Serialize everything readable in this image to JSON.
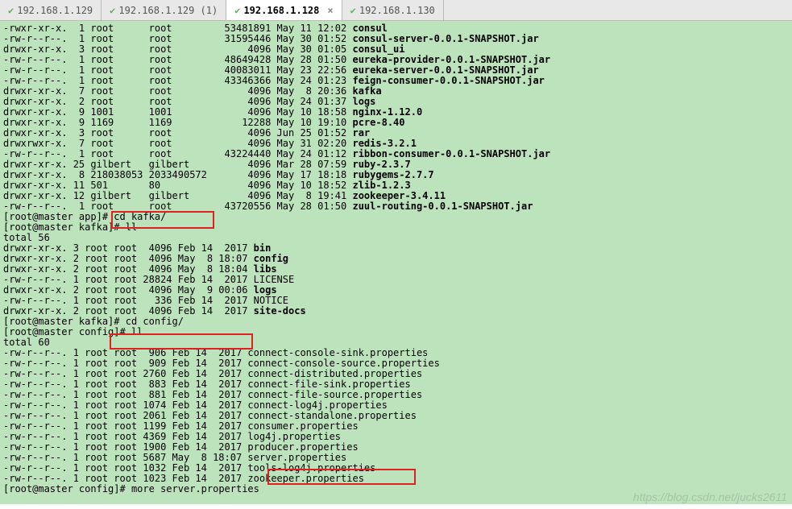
{
  "tabs": [
    {
      "label": "192.168.1.129",
      "active": false,
      "closable": false
    },
    {
      "label": "192.168.1.129 (1)",
      "active": false,
      "closable": false
    },
    {
      "label": "192.168.1.128",
      "active": true,
      "closable": true
    },
    {
      "label": "192.168.1.130",
      "active": false,
      "closable": false
    }
  ],
  "app_listing": {
    "rows": [
      {
        "perm": "-rwxr-xr-x.",
        "links": "1",
        "owner": "root",
        "group": "root",
        "size": "53481891",
        "date": "May 11 12:02",
        "name": "consul",
        "bold": true
      },
      {
        "perm": "-rw-r--r--.",
        "links": "1",
        "owner": "root",
        "group": "root",
        "size": "31595446",
        "date": "May 30 01:52",
        "name": "consul-server-0.0.1-SNAPSHOT.jar",
        "bold": true
      },
      {
        "perm": "drwxr-xr-x.",
        "links": "3",
        "owner": "root",
        "group": "root",
        "size": "4096",
        "date": "May 30 01:05",
        "name": "consul_ui",
        "bold": true
      },
      {
        "perm": "-rw-r--r--.",
        "links": "1",
        "owner": "root",
        "group": "root",
        "size": "48649428",
        "date": "May 28 01:50",
        "name": "eureka-provider-0.0.1-SNAPSHOT.jar",
        "bold": true
      },
      {
        "perm": "-rw-r--r--.",
        "links": "1",
        "owner": "root",
        "group": "root",
        "size": "40083011",
        "date": "May 23 22:56",
        "name": "eureka-server-0.0.1-SNAPSHOT.jar",
        "bold": true
      },
      {
        "perm": "-rw-r--r--.",
        "links": "1",
        "owner": "root",
        "group": "root",
        "size": "43346366",
        "date": "May 24 01:23",
        "name": "feign-consumer-0.0.1-SNAPSHOT.jar",
        "bold": true
      },
      {
        "perm": "drwxr-xr-x.",
        "links": "7",
        "owner": "root",
        "group": "root",
        "size": "4096",
        "date": "May  8 20:36",
        "name": "kafka",
        "bold": true
      },
      {
        "perm": "drwxr-xr-x.",
        "links": "2",
        "owner": "root",
        "group": "root",
        "size": "4096",
        "date": "May 24 01:37",
        "name": "logs",
        "bold": true
      },
      {
        "perm": "drwxr-xr-x.",
        "links": "9",
        "owner": "1001",
        "group": "1001",
        "size": "4096",
        "date": "May 10 18:58",
        "name": "nginx-1.12.0",
        "bold": true
      },
      {
        "perm": "drwxr-xr-x.",
        "links": "9",
        "owner": "1169",
        "group": "1169",
        "size": "12288",
        "date": "May 10 19:10",
        "name": "pcre-8.40",
        "bold": true
      },
      {
        "perm": "drwxr-xr-x.",
        "links": "3",
        "owner": "root",
        "group": "root",
        "size": "4096",
        "date": "Jun 25 01:52",
        "name": "rar",
        "bold": true
      },
      {
        "perm": "drwxrwxr-x.",
        "links": "7",
        "owner": "root",
        "group": "root",
        "size": "4096",
        "date": "May 31 02:20",
        "name": "redis-3.2.1",
        "bold": true
      },
      {
        "perm": "-rw-r--r--.",
        "links": "1",
        "owner": "root",
        "group": "root",
        "size": "43224440",
        "date": "May 24 01:12",
        "name": "ribbon-consumer-0.0.1-SNAPSHOT.jar",
        "bold": true
      },
      {
        "perm": "drwxr-xr-x.",
        "links": "25",
        "owner": "gilbert",
        "group": "gilbert",
        "size": "4096",
        "date": "Mar 28 07:59",
        "name": "ruby-2.3.7",
        "bold": true
      },
      {
        "perm": "drwxr-xr-x.",
        "links": "8",
        "owner": "218038053",
        "group": "2033490572",
        "size": "4096",
        "date": "May 17 18:18",
        "name": "rubygems-2.7.7",
        "bold": true
      },
      {
        "perm": "drwxr-xr-x.",
        "links": "11",
        "owner": "501",
        "group": "80",
        "size": "4096",
        "date": "May 10 18:52",
        "name": "zlib-1.2.3",
        "bold": true
      },
      {
        "perm": "drwxr-xr-x.",
        "links": "12",
        "owner": "gilbert",
        "group": "gilbert",
        "size": "4096",
        "date": "May  8 19:41",
        "name": "zookeeper-3.4.11",
        "bold": true
      },
      {
        "perm": "-rw-r--r--.",
        "links": "1",
        "owner": "root",
        "group": "root",
        "size": "43720556",
        "date": "May 28 01:50",
        "name": "zuul-routing-0.0.1-SNAPSHOT.jar",
        "bold": true
      }
    ]
  },
  "prompt_app": "[root@master app]#",
  "cmd_cd_kafka": " cd kafka/",
  "prompt_kafka": "[root@master kafka]#",
  "cmd_ll1": " ll",
  "total_kafka": "total 56",
  "kafka_listing": {
    "rows": [
      {
        "perm": "drwxr-xr-x.",
        "links": "3",
        "owner": "root",
        "group": "root",
        "size": "4096",
        "date": "Feb 14  2017",
        "name": "bin",
        "bold": true
      },
      {
        "perm": "drwxr-xr-x.",
        "links": "2",
        "owner": "root",
        "group": "root",
        "size": "4096",
        "date": "May  8 18:07",
        "name": "config",
        "bold": true
      },
      {
        "perm": "drwxr-xr-x.",
        "links": "2",
        "owner": "root",
        "group": "root",
        "size": "4096",
        "date": "May  8 18:04",
        "name": "libs",
        "bold": true
      },
      {
        "perm": "-rw-r--r--.",
        "links": "1",
        "owner": "root",
        "group": "root",
        "size": "28824",
        "date": "Feb 14  2017",
        "name": "LICENSE",
        "bold": false
      },
      {
        "perm": "drwxr-xr-x.",
        "links": "2",
        "owner": "root",
        "group": "root",
        "size": "4096",
        "date": "May  9 00:06",
        "name": "logs",
        "bold": true
      },
      {
        "perm": "-rw-r--r--.",
        "links": "1",
        "owner": "root",
        "group": "root",
        "size": "336",
        "date": "Feb 14  2017",
        "name": "NOTICE",
        "bold": false
      },
      {
        "perm": "drwxr-xr-x.",
        "links": "2",
        "owner": "root",
        "group": "root",
        "size": "4096",
        "date": "Feb 14  2017",
        "name": "site-docs",
        "bold": true
      }
    ]
  },
  "cmd_cd_config": " cd config/",
  "prompt_config": "[root@master config]#",
  "cmd_ll2": " ll",
  "total_config": "total 60",
  "config_listing": {
    "rows": [
      {
        "perm": "-rw-r--r--.",
        "links": "1",
        "owner": "root",
        "group": "root",
        "size": "906",
        "date": "Feb 14  2017",
        "name": "connect-console-sink.properties"
      },
      {
        "perm": "-rw-r--r--.",
        "links": "1",
        "owner": "root",
        "group": "root",
        "size": "909",
        "date": "Feb 14  2017",
        "name": "connect-console-source.properties"
      },
      {
        "perm": "-rw-r--r--.",
        "links": "1",
        "owner": "root",
        "group": "root",
        "size": "2760",
        "date": "Feb 14  2017",
        "name": "connect-distributed.properties"
      },
      {
        "perm": "-rw-r--r--.",
        "links": "1",
        "owner": "root",
        "group": "root",
        "size": "883",
        "date": "Feb 14  2017",
        "name": "connect-file-sink.properties"
      },
      {
        "perm": "-rw-r--r--.",
        "links": "1",
        "owner": "root",
        "group": "root",
        "size": "881",
        "date": "Feb 14  2017",
        "name": "connect-file-source.properties"
      },
      {
        "perm": "-rw-r--r--.",
        "links": "1",
        "owner": "root",
        "group": "root",
        "size": "1074",
        "date": "Feb 14  2017",
        "name": "connect-log4j.properties"
      },
      {
        "perm": "-rw-r--r--.",
        "links": "1",
        "owner": "root",
        "group": "root",
        "size": "2061",
        "date": "Feb 14  2017",
        "name": "connect-standalone.properties"
      },
      {
        "perm": "-rw-r--r--.",
        "links": "1",
        "owner": "root",
        "group": "root",
        "size": "1199",
        "date": "Feb 14  2017",
        "name": "consumer.properties"
      },
      {
        "perm": "-rw-r--r--.",
        "links": "1",
        "owner": "root",
        "group": "root",
        "size": "4369",
        "date": "Feb 14  2017",
        "name": "log4j.properties"
      },
      {
        "perm": "-rw-r--r--.",
        "links": "1",
        "owner": "root",
        "group": "root",
        "size": "1900",
        "date": "Feb 14  2017",
        "name": "producer.properties"
      },
      {
        "perm": "-rw-r--r--.",
        "links": "1",
        "owner": "root",
        "group": "root",
        "size": "5687",
        "date": "May  8 18:07",
        "name": "server.properties"
      },
      {
        "perm": "-rw-r--r--.",
        "links": "1",
        "owner": "root",
        "group": "root",
        "size": "1032",
        "date": "Feb 14  2017",
        "name": "tools-log4j.properties"
      },
      {
        "perm": "-rw-r--r--.",
        "links": "1",
        "owner": "root",
        "group": "root",
        "size": "1023",
        "date": "Feb 14  2017",
        "name": "zookeeper.properties"
      }
    ]
  },
  "cmd_more": " more server.properties",
  "watermark": "https://blog.csdn.net/jucks2611"
}
